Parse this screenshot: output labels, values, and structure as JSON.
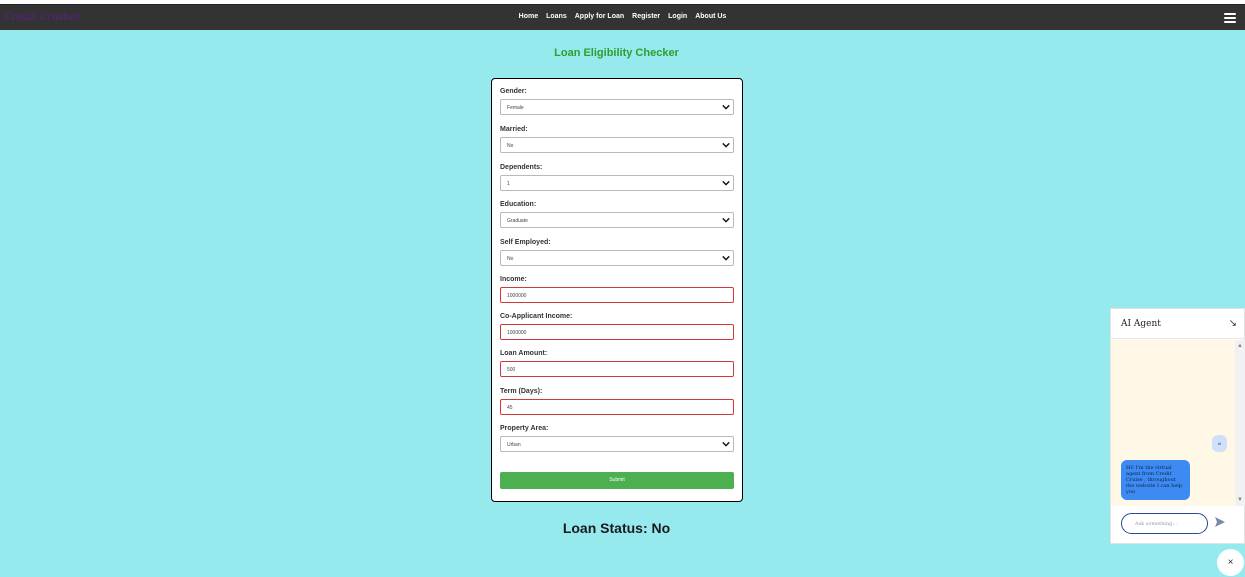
{
  "nav": {
    "brand": "Credit Crusher",
    "links": [
      "Home",
      "Loans",
      "Apply for Loan",
      "Register",
      "Login",
      "About Us"
    ]
  },
  "page": {
    "title": "Loan Eligibility Checker",
    "status": "Loan Status: No"
  },
  "form": {
    "fields": [
      {
        "label": "Gender:",
        "value": "Female",
        "type": "select"
      },
      {
        "label": "Married:",
        "value": "No",
        "type": "select"
      },
      {
        "label": "Dependents:",
        "value": "1",
        "type": "select"
      },
      {
        "label": "Education:",
        "value": "Graduate",
        "type": "select"
      },
      {
        "label": "Self Employed:",
        "value": "No",
        "type": "select"
      },
      {
        "label": "Income:",
        "value": "1000000",
        "type": "input"
      },
      {
        "label": "Co-Applicant Income:",
        "value": "1000000",
        "type": "input"
      },
      {
        "label": "Loan Amount:",
        "value": "500",
        "type": "input"
      },
      {
        "label": "Term (Days):",
        "value": "45",
        "type": "input"
      },
      {
        "label": "Property Area:",
        "value": "Urban",
        "type": "select"
      }
    ],
    "submit_label": "Submit"
  },
  "chat": {
    "title": "AI Agent",
    "minimize_icon": "↘",
    "messages": [
      {
        "from": "user",
        "text": "hi"
      },
      {
        "from": "bot",
        "text": "Hi! I'm the virtual agent from Credit Cruise , throughout the website I can help you"
      }
    ],
    "input_placeholder": "Ask something...",
    "close_icon": "×"
  },
  "colors": {
    "background": "#96eaee",
    "navbar": "#333333",
    "title_green": "#2e9e2e",
    "submit_green": "#4caf50",
    "error_border": "#d23a3a",
    "chat_body": "#fff8e6",
    "bot_bubble": "#3d8bf2",
    "user_bubble": "#cfe0fb"
  }
}
